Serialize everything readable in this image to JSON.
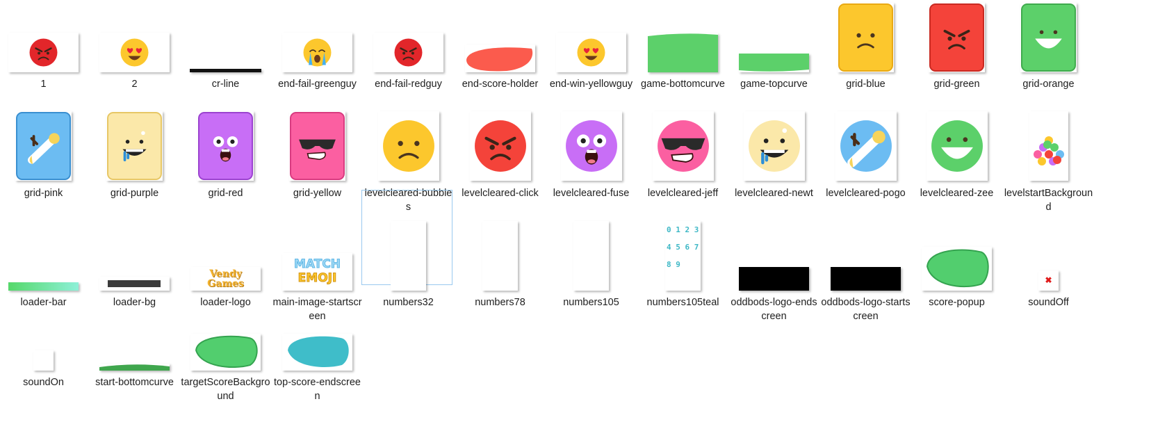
{
  "files": [
    {
      "name": "1",
      "icon": "angry-red-face-icon"
    },
    {
      "name": "2",
      "icon": "heart-eyes-face-icon"
    },
    {
      "name": "cr-line",
      "icon": "black-line-icon"
    },
    {
      "name": "end-fail-greenguy",
      "icon": "crying-face-icon"
    },
    {
      "name": "end-fail-redguy",
      "icon": "angry-red-face-icon"
    },
    {
      "name": "end-score-holder",
      "icon": "red-blob-icon"
    },
    {
      "name": "end-win-yellowguy",
      "icon": "heart-eyes-face-icon"
    },
    {
      "name": "game-bottomcurve",
      "icon": "green-curve-icon"
    },
    {
      "name": "game-topcurve",
      "icon": "green-curve-icon"
    },
    {
      "name": "grid-blue",
      "icon": "yellow-sad-card-icon"
    },
    {
      "name": "grid-green",
      "icon": "red-angry-card-icon"
    },
    {
      "name": "grid-orange",
      "icon": "green-smile-card-icon"
    },
    {
      "name": "grid-pink",
      "icon": "blue-card-icon"
    },
    {
      "name": "grid-purple",
      "icon": "yellow-drool-card-icon"
    },
    {
      "name": "grid-red",
      "icon": "purple-shock-card-icon"
    },
    {
      "name": "grid-yellow",
      "icon": "pink-sunglasses-card-icon"
    },
    {
      "name": "levelcleared-bubbles",
      "icon": "yellow-sad-face-icon"
    },
    {
      "name": "levelcleared-click",
      "icon": "red-angry-face-icon"
    },
    {
      "name": "levelcleared-fuse",
      "icon": "purple-shock-face-icon"
    },
    {
      "name": "levelcleared-jeff",
      "icon": "pink-sunglasses-face-icon"
    },
    {
      "name": "levelcleared-newt",
      "icon": "yellow-drool-face-icon"
    },
    {
      "name": "levelcleared-pogo",
      "icon": "blue-face-icon"
    },
    {
      "name": "levelcleared-zee",
      "icon": "green-smile-face-icon"
    },
    {
      "name": "levelstartBackground",
      "icon": "emoji-pile-icon"
    },
    {
      "name": "loader-bar",
      "icon": "green-gradient-bar-icon"
    },
    {
      "name": "loader-bg",
      "icon": "dark-bar-icon"
    },
    {
      "name": "loader-logo",
      "icon": "vendy-games-logo-icon",
      "logo_lines": [
        "Vendy",
        "Games"
      ]
    },
    {
      "name": "main-image-startscreen",
      "icon": "match-emoji-logo-icon",
      "logo_lines": [
        "MATCH",
        "EMOJI"
      ]
    },
    {
      "name": "numbers32",
      "icon": "blank-sheet-icon"
    },
    {
      "name": "numbers78",
      "icon": "blank-sheet-icon"
    },
    {
      "name": "numbers105",
      "icon": "blank-sheet-icon"
    },
    {
      "name": "numbers105teal",
      "icon": "teal-digits-icon",
      "digits": [
        "0 1 2 3",
        "4 5 6 7",
        "8 9"
      ]
    },
    {
      "name": "oddbods-logo-endscreen",
      "icon": "black-block-icon"
    },
    {
      "name": "oddbods-logo-startscreen",
      "icon": "black-block-icon"
    },
    {
      "name": "score-popup",
      "icon": "green-blob-icon"
    },
    {
      "name": "soundOff",
      "icon": "red-x-icon"
    },
    {
      "name": "soundOn",
      "icon": "blank-icon"
    },
    {
      "name": "start-bottomcurve",
      "icon": "green-curve-icon"
    },
    {
      "name": "targetScoreBackground",
      "icon": "green-blob-icon"
    },
    {
      "name": "top-score-endscreen",
      "icon": "teal-blob-icon"
    }
  ],
  "selected": "numbers32",
  "colors": {
    "selection_border": "#99c9ef",
    "green": "#5cd06a",
    "red": "#f4433a",
    "teal": "#3fbdc9",
    "yellow": "#fcc72d"
  }
}
